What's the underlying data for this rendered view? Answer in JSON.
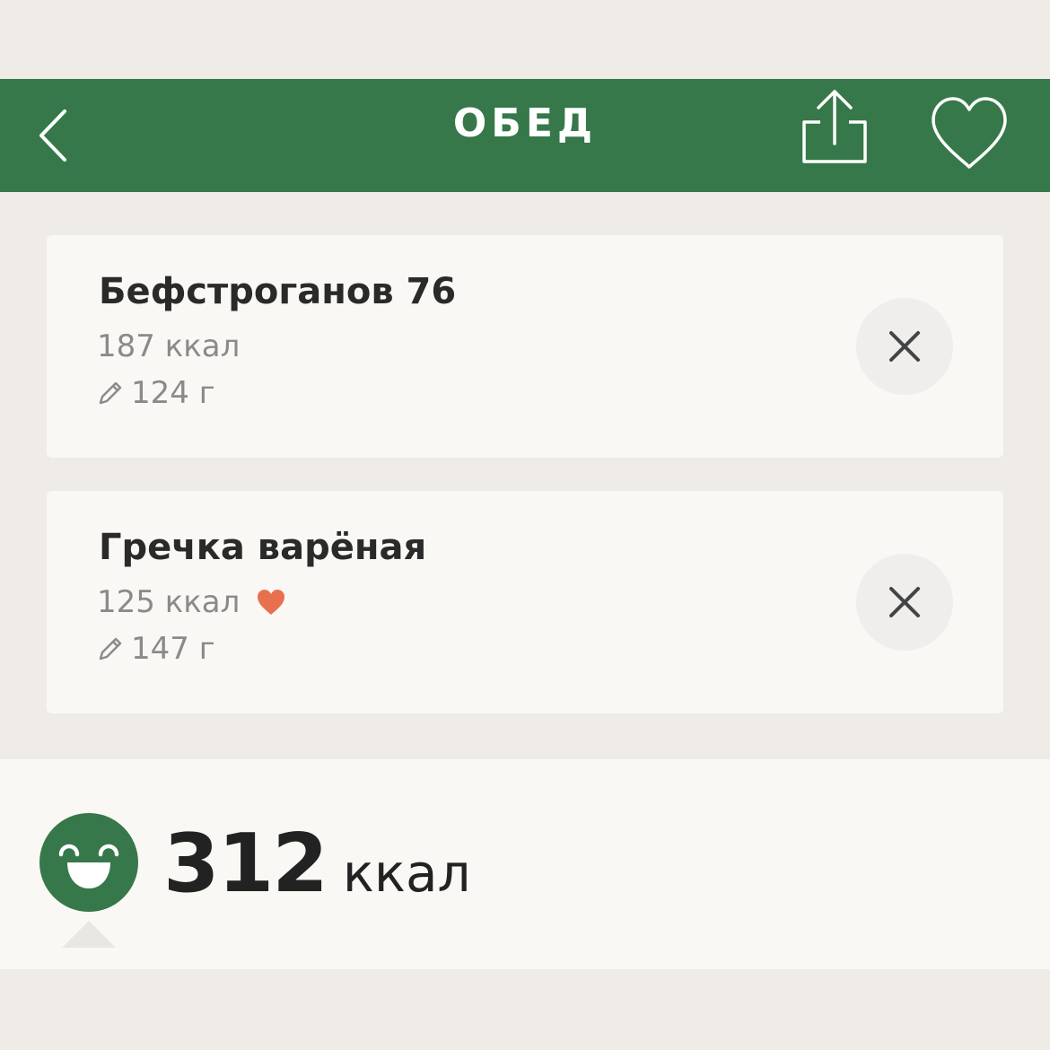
{
  "header": {
    "title": "ОБЕД",
    "background": "#367849",
    "back_icon": "chevron-left-icon",
    "share_icon": "share-icon",
    "favorite_icon": "heart-outline-icon"
  },
  "items": [
    {
      "name": "Бефстроганов 76",
      "kcal": "187 ккал",
      "weight": "124 г",
      "favorite": false
    },
    {
      "name": "Гречка варёная",
      "kcal": "125 ккал",
      "weight": "147 г",
      "favorite": true
    }
  ],
  "summary": {
    "total_value": "312",
    "total_unit": "ккал",
    "mood_icon": "happy-face-icon"
  },
  "colors": {
    "accent": "#367849",
    "favorite_heart": "#e8704f",
    "background": "#efebe6",
    "card": "#faf8f4"
  }
}
